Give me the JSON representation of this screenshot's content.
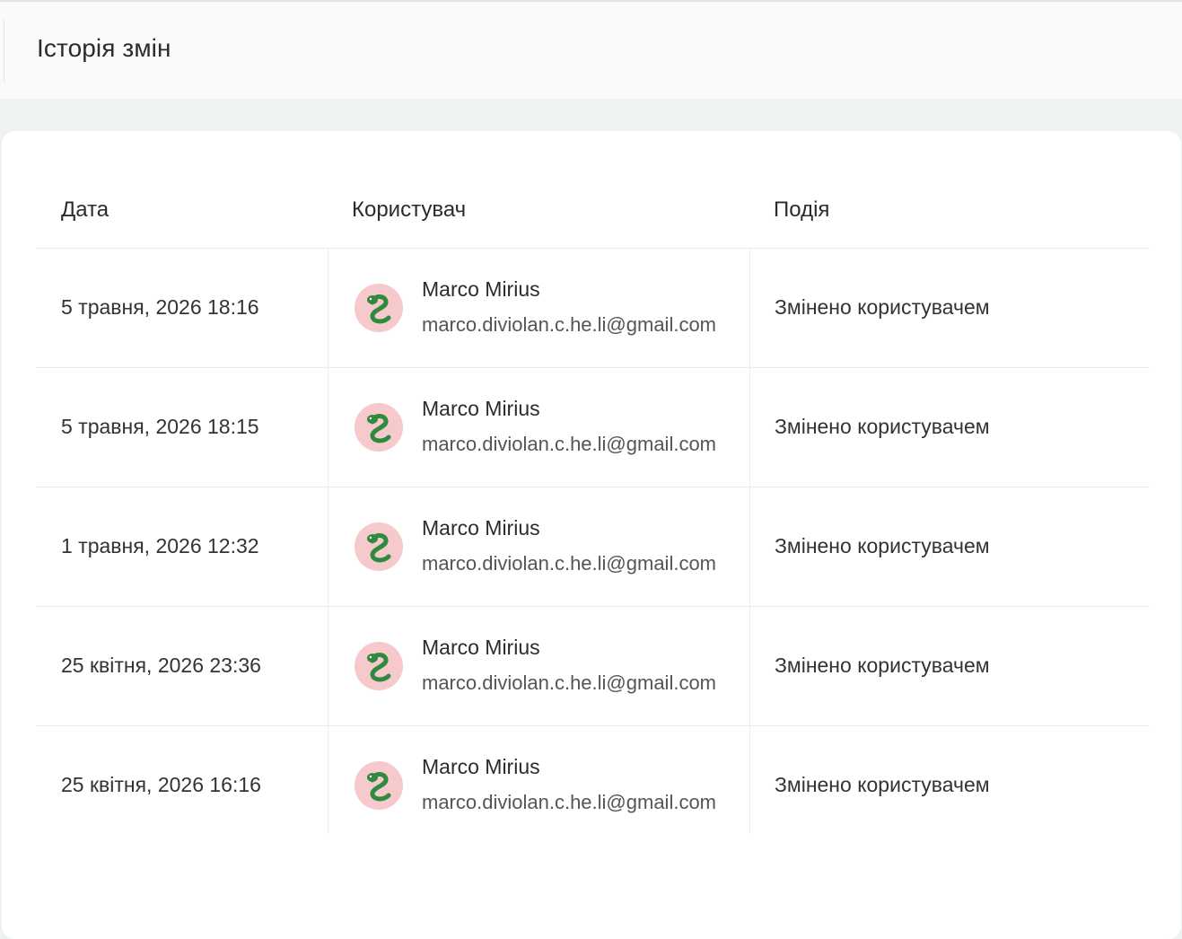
{
  "header": {
    "title": "Історія змін"
  },
  "table": {
    "columns": {
      "date": "Дата",
      "user": "Користувач",
      "event": "Подія"
    },
    "rows": [
      {
        "date": "5 травня, 2026 18:16",
        "user_name": "Marco Mirius",
        "user_email": "marco.diviolan.c.he.li@gmail.com",
        "event": "Змінено користувачем"
      },
      {
        "date": "5 травня, 2026 18:15",
        "user_name": "Marco Mirius",
        "user_email": "marco.diviolan.c.he.li@gmail.com",
        "event": "Змінено користувачем"
      },
      {
        "date": "1 травня, 2026 12:32",
        "user_name": "Marco Mirius",
        "user_email": "marco.diviolan.c.he.li@gmail.com",
        "event": "Змінено користувачем"
      },
      {
        "date": "25 квітня, 2026 23:36",
        "user_name": "Marco Mirius",
        "user_email": "marco.diviolan.c.he.li@gmail.com",
        "event": "Змінено користувачем"
      },
      {
        "date": "25 квітня, 2026 16:16",
        "user_name": "Marco Mirius",
        "user_email": "marco.diviolan.c.he.li@gmail.com",
        "event": "Змінено користувачем"
      }
    ]
  },
  "avatar": {
    "icon": "snake-icon",
    "background_color": "#f6c9cc",
    "icon_color": "#2e8b3e"
  }
}
